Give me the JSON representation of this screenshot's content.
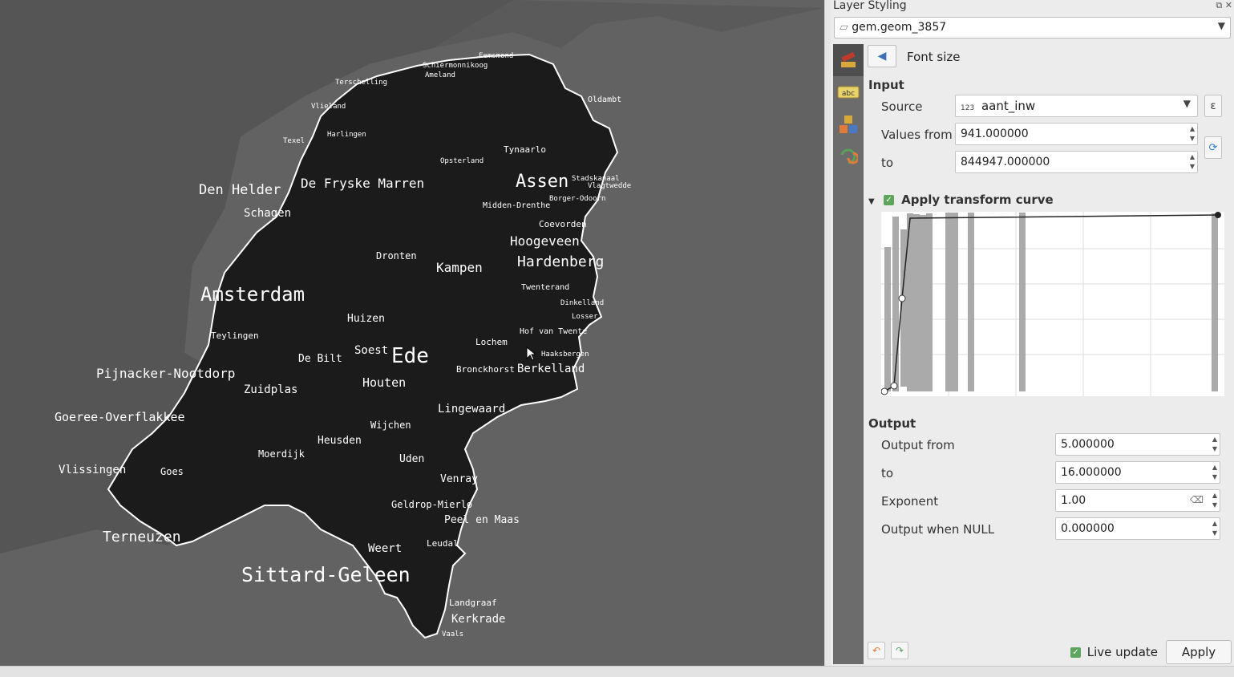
{
  "map": {
    "labels": [
      {
        "t": "Schiermonnikoog"
      },
      {
        "t": "Ameland"
      },
      {
        "t": "Eemsmond"
      },
      {
        "t": "Terschelling"
      },
      {
        "t": "Vlieland"
      },
      {
        "t": "Harlingen"
      },
      {
        "t": "Texel"
      },
      {
        "t": "Den Helder"
      },
      {
        "t": "De Fryske Marren"
      },
      {
        "t": "Schagen"
      },
      {
        "t": "Assen"
      },
      {
        "t": "Oldambt"
      },
      {
        "t": "Stadskanaal"
      },
      {
        "t": "Vlagtwedde"
      },
      {
        "t": "Borger-Odoorn"
      },
      {
        "t": "Midden-Drenthe"
      },
      {
        "t": "Coevorden"
      },
      {
        "t": "Hoogeveen"
      },
      {
        "t": "Hardenberg"
      },
      {
        "t": "Kampen"
      },
      {
        "t": "Dronten"
      },
      {
        "t": "Amsterdam"
      },
      {
        "t": "Twenterand"
      },
      {
        "t": "Dinkelland"
      },
      {
        "t": "Losser"
      },
      {
        "t": "Huizen"
      },
      {
        "t": "Soest"
      },
      {
        "t": "Ede"
      },
      {
        "t": "Pijnacker-Nootdorp"
      },
      {
        "t": "De Bilt"
      },
      {
        "t": "Berkelland"
      },
      {
        "t": "Houten"
      },
      {
        "t": "Zuidplas"
      },
      {
        "t": "Goeree-Overflakkee"
      },
      {
        "t": "Lingewaard"
      },
      {
        "t": "Heusden"
      },
      {
        "t": "Vlissingen"
      },
      {
        "t": "Goes"
      },
      {
        "t": "Terneuzen"
      },
      {
        "t": "Uden"
      },
      {
        "t": "Venray"
      },
      {
        "t": "Geldrop-Mierlo"
      },
      {
        "t": "Peel en Maas"
      },
      {
        "t": "Weert"
      },
      {
        "t": "Sittard-Geleen"
      },
      {
        "t": "Kerkrade"
      },
      {
        "t": "Landgraaf"
      },
      {
        "t": "Vaals"
      },
      {
        "t": "Leudal"
      },
      {
        "t": "Tynaarlo"
      },
      {
        "t": "Opsterland"
      },
      {
        "t": "Lochem"
      },
      {
        "t": "Bronckhorst"
      },
      {
        "t": "Wijchen"
      },
      {
        "t": "Moerdijk"
      },
      {
        "t": "Teylingen"
      },
      {
        "t": "Haaksbergen"
      },
      {
        "t": "Hof van Twente"
      }
    ]
  },
  "panel": {
    "title": "Layer Styling",
    "layer": "gem.geom_3857",
    "page_title": "Font size",
    "input_section": "Input",
    "source_label": "Source",
    "source_value": "aant_inw",
    "source_tag": "123",
    "values_from_label": "Values from",
    "values_from": "941.000000",
    "to_label": "to",
    "values_to": "844947.000000",
    "transform_label": "Apply transform curve",
    "output_section": "Output",
    "output_from_label": "Output from",
    "output_from": "5.000000",
    "output_to_label": "to",
    "output_to": "16.000000",
    "exponent_label": "Exponent",
    "exponent": "1.00",
    "null_label": "Output when NULL",
    "null_value": "0.000000",
    "live_update": "Live update",
    "apply": "Apply"
  }
}
